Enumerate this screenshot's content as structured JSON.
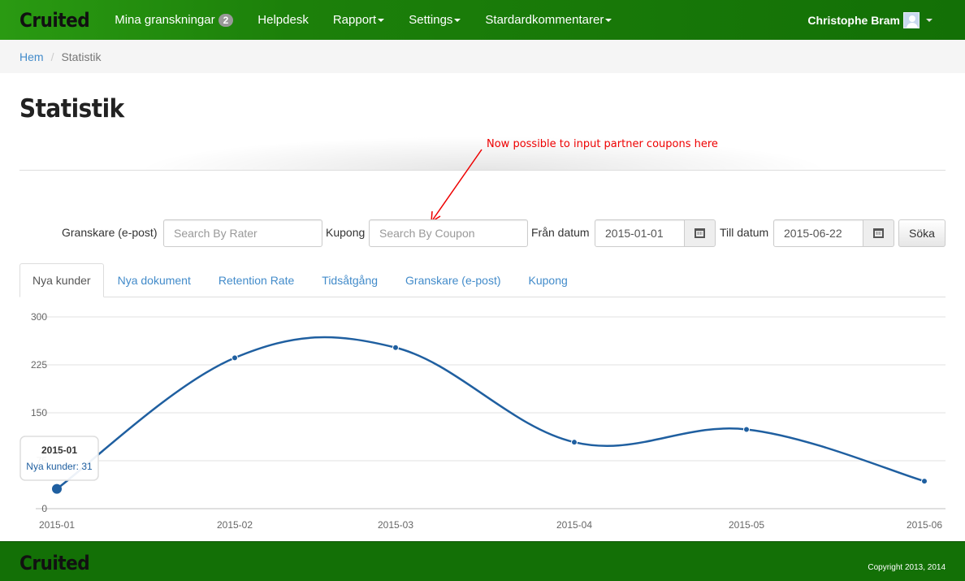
{
  "navbar": {
    "brand": "Cruited",
    "items": [
      {
        "label": "Mina granskningar",
        "badge": "2",
        "dropdown": false
      },
      {
        "label": "Helpdesk",
        "dropdown": false
      },
      {
        "label": "Rapport",
        "dropdown": true
      },
      {
        "label": "Settings",
        "dropdown": true
      },
      {
        "label": "Stardardkommentarer",
        "dropdown": true
      }
    ],
    "user": "Christophe Bram"
  },
  "breadcrumb": {
    "home": "Hem",
    "current": "Statistik"
  },
  "page_title": "Statistik",
  "annotation": "Now possible to input partner coupons here",
  "filters": {
    "rater_label": "Granskare (e-post)",
    "rater_placeholder": "Search By Rater",
    "coupon_label": "Kupong",
    "coupon_placeholder": "Search By Coupon",
    "from_label": "Från datum",
    "from_value": "2015-01-01",
    "to_label": "Till datum",
    "to_value": "2015-06-22",
    "search_button": "Söka"
  },
  "tabs": [
    {
      "label": "Nya kunder",
      "active": true
    },
    {
      "label": "Nya dokument",
      "active": false
    },
    {
      "label": "Retention Rate",
      "active": false
    },
    {
      "label": "Tidsåtgång",
      "active": false
    },
    {
      "label": "Granskare (e-post)",
      "active": false
    },
    {
      "label": "Kupong",
      "active": false
    }
  ],
  "chart_data": {
    "type": "line",
    "categories": [
      "2015-01",
      "2015-02",
      "2015-03",
      "2015-04",
      "2015-05",
      "2015-06"
    ],
    "series": [
      {
        "name": "Nya kunder",
        "values": [
          31,
          236,
          252,
          104,
          124,
          43
        ]
      }
    ],
    "yticks": [
      0,
      75,
      150,
      225,
      300
    ],
    "ylim": [
      0,
      300
    ],
    "grid": true,
    "line_color": "#1f5fa0",
    "tooltip": {
      "title": "2015-01",
      "text": "Nya kunder: 31"
    }
  },
  "footer": {
    "brand": "Cruited",
    "copyright": "Copyright 2013, 2014"
  }
}
